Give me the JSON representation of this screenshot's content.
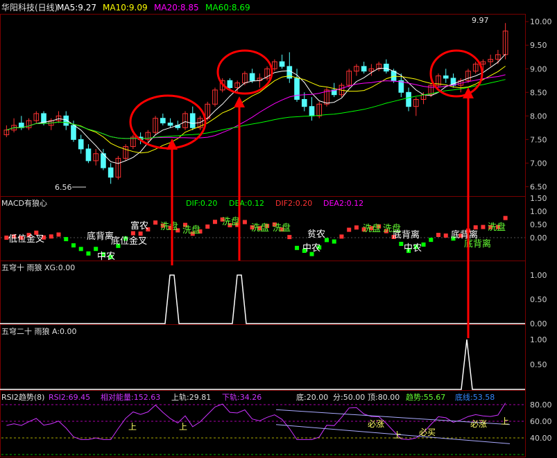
{
  "colors": {
    "bg": "#000000",
    "frame": "#7a0000",
    "grid": "#5a0000",
    "axis_text": "#d0d0d0",
    "up": "#ff3232",
    "down": "#54fcfc",
    "ma5": "#ffffff",
    "ma10": "#ffff00",
    "ma20": "#ff00ff",
    "ma60": "#00ff00",
    "annot": "#ff0000",
    "signal_line": "#ffffff",
    "rsi": "#cc33ff",
    "label_green": "#66ff33",
    "label_yellow": "#ffff66"
  },
  "main": {
    "title": "华阳科技(日线)",
    "ma5_label": "MA5:9.27",
    "ma10_label": "MA10:9.09",
    "ma20_label": "MA20:8.85",
    "ma60_label": "MA60:8.69",
    "high_marker": "9.97",
    "low_marker": "6.56",
    "y_ticks": [
      "10.00",
      "9.50",
      "9.00",
      "8.50",
      "8.00",
      "7.50",
      "7.00",
      "6.50"
    ]
  },
  "macd": {
    "title": "MACD有狼心",
    "dif": "DIF:0.20",
    "dea": "DEA:0.12",
    "dif2": "DIF2:0.20",
    "dea2": "DEA2:0.12",
    "y_ticks": [
      "1.50",
      "1.00",
      "0.50",
      "0.00"
    ],
    "labels": [
      "低位金叉",
      "底背离",
      "底位金叉",
      "富农",
      "中农",
      "洗盘",
      "洗盘",
      "洗盘",
      "洗盘",
      "洗盘",
      "贫农",
      "中农",
      "洗盘",
      "洗盘",
      "底背离",
      "中农",
      "底背离",
      "洗盘",
      "底背离"
    ]
  },
  "xg": {
    "title": "五穹十 雨狼 XG:0.00",
    "y_ticks": [
      "1.00",
      "0.50",
      "0.00"
    ]
  },
  "a": {
    "title": "五穹二十 雨狼 A:0.00",
    "y_ticks": [
      "1.00",
      "0.50"
    ]
  },
  "rsi": {
    "title": "RSI2趋势(8)",
    "rsi2": "RSI2:69.45",
    "relative": "相对能量:152.63",
    "upper": "上轨:29.81",
    "lower": "下轨:34.26",
    "bottom": "底:20.00",
    "mid": "分:50.00",
    "top": "顶:80.00",
    "trend": "趋势:55.67",
    "base": "底线:53.58",
    "y_ticks": [
      "80.00",
      "60.00",
      "40.00"
    ],
    "labels": [
      "上",
      "上",
      "上",
      "必涨",
      "必买",
      "必涨",
      "上"
    ]
  },
  "chart_data": [
    {
      "type": "candlestick",
      "title": "华阳科技(日线)",
      "ylim": [
        6.3,
        10.15
      ],
      "ohlc": [
        [
          7.6,
          7.8,
          7.55,
          7.7
        ],
        [
          7.7,
          7.95,
          7.65,
          7.8
        ],
        [
          7.85,
          8.0,
          7.7,
          7.75
        ],
        [
          7.75,
          7.95,
          7.7,
          7.9
        ],
        [
          7.9,
          8.1,
          7.85,
          8.05
        ],
        [
          8.05,
          8.1,
          7.8,
          7.85
        ],
        [
          7.8,
          7.95,
          7.7,
          7.9
        ],
        [
          7.9,
          8.1,
          7.85,
          8.0
        ],
        [
          8.0,
          8.1,
          7.7,
          7.8
        ],
        [
          7.8,
          7.9,
          7.45,
          7.5
        ],
        [
          7.5,
          7.6,
          7.2,
          7.3
        ],
        [
          7.3,
          7.4,
          7.0,
          7.05
        ],
        [
          7.05,
          7.3,
          6.95,
          7.2
        ],
        [
          7.2,
          7.3,
          6.85,
          6.9
        ],
        [
          6.9,
          7.0,
          6.56,
          6.7
        ],
        [
          6.7,
          7.15,
          6.65,
          7.1
        ],
        [
          7.1,
          7.4,
          7.05,
          7.35
        ],
        [
          7.35,
          7.6,
          7.3,
          7.55
        ],
        [
          7.55,
          7.65,
          7.4,
          7.5
        ],
        [
          7.5,
          7.7,
          7.45,
          7.65
        ],
        [
          7.65,
          8.0,
          7.6,
          7.95
        ],
        [
          7.95,
          8.05,
          7.8,
          7.85
        ],
        [
          7.85,
          7.95,
          7.75,
          7.8
        ],
        [
          7.8,
          7.9,
          7.7,
          7.75
        ],
        [
          7.75,
          8.1,
          7.7,
          8.05
        ],
        [
          8.05,
          8.2,
          7.7,
          7.75
        ],
        [
          7.75,
          8.0,
          7.7,
          7.95
        ],
        [
          7.95,
          8.3,
          7.9,
          8.25
        ],
        [
          8.25,
          8.6,
          8.2,
          8.55
        ],
        [
          8.55,
          8.8,
          8.5,
          8.75
        ],
        [
          8.75,
          8.8,
          8.55,
          8.6
        ],
        [
          8.6,
          8.75,
          8.5,
          8.7
        ],
        [
          8.7,
          8.95,
          8.65,
          8.9
        ],
        [
          8.9,
          9.0,
          8.7,
          8.75
        ],
        [
          8.75,
          8.9,
          8.6,
          8.8
        ],
        [
          8.8,
          9.05,
          8.75,
          9.0
        ],
        [
          9.0,
          9.2,
          8.95,
          9.15
        ],
        [
          9.15,
          9.3,
          9.0,
          9.05
        ],
        [
          9.05,
          9.35,
          8.7,
          8.8
        ],
        [
          8.8,
          9.0,
          8.3,
          8.35
        ],
        [
          8.35,
          8.5,
          8.1,
          8.2
        ],
        [
          8.2,
          8.4,
          7.9,
          8.0
        ],
        [
          8.0,
          8.3,
          7.95,
          8.25
        ],
        [
          8.25,
          8.6,
          8.2,
          8.55
        ],
        [
          8.55,
          8.7,
          8.4,
          8.45
        ],
        [
          8.45,
          8.7,
          8.4,
          8.65
        ],
        [
          8.65,
          9.0,
          8.6,
          8.95
        ],
        [
          8.95,
          9.1,
          8.85,
          9.05
        ],
        [
          9.05,
          9.15,
          8.9,
          8.95
        ],
        [
          8.95,
          9.1,
          8.85,
          9.0
        ],
        [
          9.0,
          9.15,
          8.95,
          9.1
        ],
        [
          9.1,
          9.2,
          8.9,
          8.95
        ],
        [
          8.95,
          9.0,
          8.7,
          8.75
        ],
        [
          8.75,
          8.9,
          8.4,
          8.5
        ],
        [
          8.5,
          8.6,
          8.1,
          8.2
        ],
        [
          8.2,
          8.4,
          8.0,
          8.35
        ],
        [
          8.35,
          8.5,
          8.25,
          8.45
        ],
        [
          8.45,
          8.7,
          8.4,
          8.65
        ],
        [
          8.65,
          8.9,
          8.6,
          8.85
        ],
        [
          8.85,
          9.0,
          8.7,
          8.8
        ],
        [
          8.8,
          8.9,
          8.6,
          8.65
        ],
        [
          8.65,
          8.8,
          8.5,
          8.75
        ],
        [
          8.75,
          9.0,
          8.7,
          8.95
        ],
        [
          8.95,
          9.15,
          8.9,
          9.1
        ],
        [
          9.1,
          9.2,
          8.95,
          9.15
        ],
        [
          9.15,
          9.3,
          9.05,
          9.2
        ],
        [
          9.2,
          9.4,
          9.1,
          9.3
        ],
        [
          9.3,
          9.97,
          9.2,
          9.8
        ]
      ]
    },
    {
      "type": "line",
      "title": "五穹十 雨狼 XG:0.00",
      "x": [
        "spike1",
        "spike2"
      ],
      "values": [
        1,
        1
      ],
      "ylim": [
        0,
        1.1
      ]
    },
    {
      "type": "line",
      "title": "五穹二十 雨狼 A:0.00",
      "values": [
        1
      ],
      "ylim": [
        0,
        1.1
      ]
    }
  ]
}
